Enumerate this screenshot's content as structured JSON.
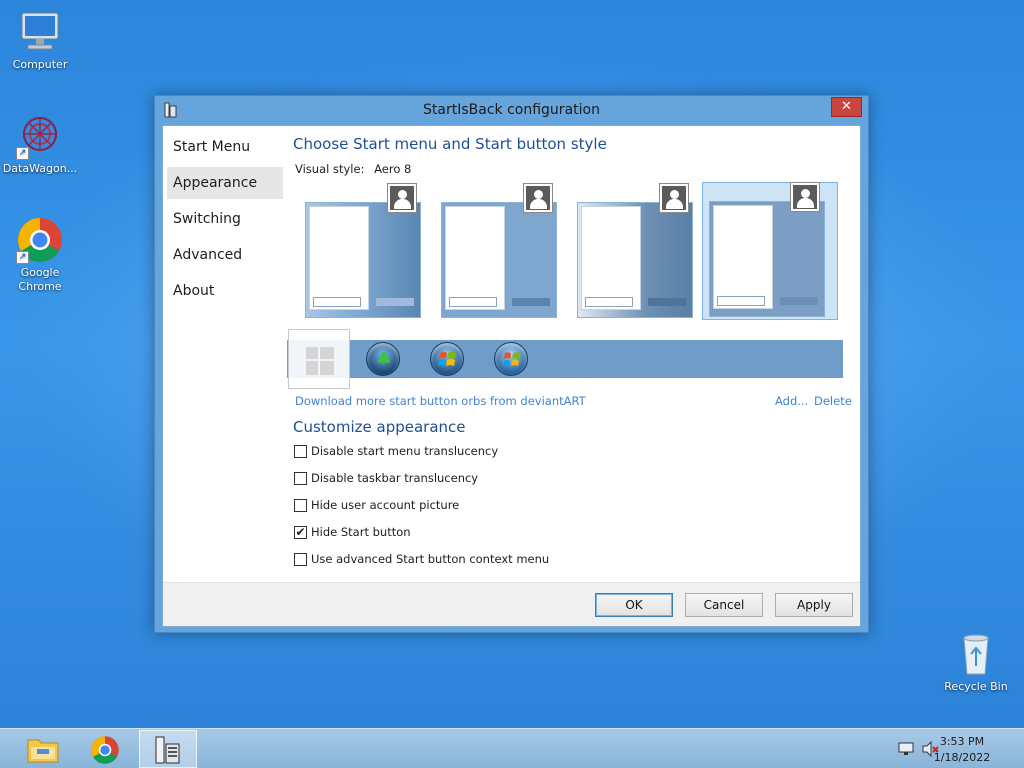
{
  "desktop": {
    "icons": [
      {
        "label": "Computer"
      },
      {
        "label": "DataWagon..."
      },
      {
        "label": "Google Chrome"
      },
      {
        "label": "Recycle Bin"
      }
    ]
  },
  "window": {
    "title": "StartIsBack configuration",
    "close_glyph": "✕",
    "nav": [
      {
        "label": "Start Menu",
        "selected": false
      },
      {
        "label": "Appearance",
        "selected": true
      },
      {
        "label": "Switching",
        "selected": false
      },
      {
        "label": "Advanced",
        "selected": false
      },
      {
        "label": "About",
        "selected": false
      }
    ],
    "style_section": {
      "heading": "Choose Start menu and Start button style",
      "visual_style_label": "Visual style:",
      "visual_style_value": "Aero 8",
      "selected_style_index": 3,
      "download_link": "Download more start button orbs from deviantART",
      "add_link": "Add...",
      "delete_link": "Delete"
    },
    "customize_section": {
      "heading": "Customize appearance",
      "options": [
        {
          "label": "Disable start menu translucency",
          "checked": false
        },
        {
          "label": "Disable taskbar translucency",
          "checked": false
        },
        {
          "label": "Hide user account picture",
          "checked": false
        },
        {
          "label": "Hide Start button",
          "checked": true
        },
        {
          "label": "Use advanced Start button context menu",
          "checked": false
        }
      ]
    },
    "buttons": {
      "ok": "OK",
      "cancel": "Cancel",
      "apply": "Apply"
    }
  },
  "taskbar": {
    "clock_time": "3:53 PM",
    "clock_date": "1/18/2022"
  },
  "colors": {
    "heading": "#1e4f95",
    "link": "#3e84d1",
    "close_button": "#c7473e"
  }
}
